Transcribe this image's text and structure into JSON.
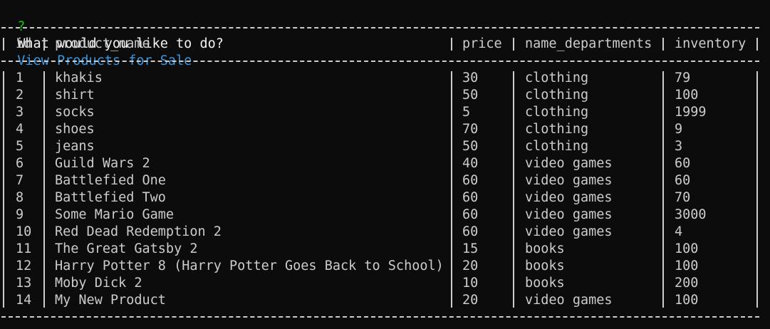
{
  "prompt": {
    "symbol": "?",
    "question": "What would you like to do?",
    "answer": "View Products for Sale"
  },
  "table": {
    "headers": [
      "id",
      "product_name",
      "price",
      "name_departments",
      "inventory"
    ],
    "rows": [
      [
        "1",
        "khakis",
        "30",
        "clothing",
        "79"
      ],
      [
        "2",
        "shirt",
        "50",
        "clothing",
        "100"
      ],
      [
        "3",
        "socks",
        "5",
        "clothing",
        "1999"
      ],
      [
        "4",
        "shoes",
        "70",
        "clothing",
        "9"
      ],
      [
        "5",
        "jeans",
        "50",
        "clothing",
        "3"
      ],
      [
        "6",
        "Guild Wars 2",
        "40",
        "video games",
        "60"
      ],
      [
        "7",
        "Battlefied One",
        "60",
        "video games",
        "60"
      ],
      [
        "8",
        "Battlefied Two",
        "60",
        "video games",
        "70"
      ],
      [
        "9",
        "Some Mario Game",
        "60",
        "video games",
        "3000"
      ],
      [
        "10",
        "Red Dead Redemption 2",
        "60",
        "video games",
        "4"
      ],
      [
        "11",
        "The Great Gatsby 2",
        "15",
        "books",
        "100"
      ],
      [
        "12",
        "Harry Potter 8 (Harry Potter Goes Back to School)",
        "20",
        "books",
        "100"
      ],
      [
        "13",
        "Moby Dick 2",
        "10",
        "books",
        "200"
      ],
      [
        "14",
        "My New Product",
        "20",
        "video games",
        "100"
      ]
    ]
  },
  "colors": {
    "background": "#0c0c0c",
    "text": "#cccccc",
    "prompt_symbol": "#16c60c",
    "prompt_answer": "#3a96dd"
  }
}
